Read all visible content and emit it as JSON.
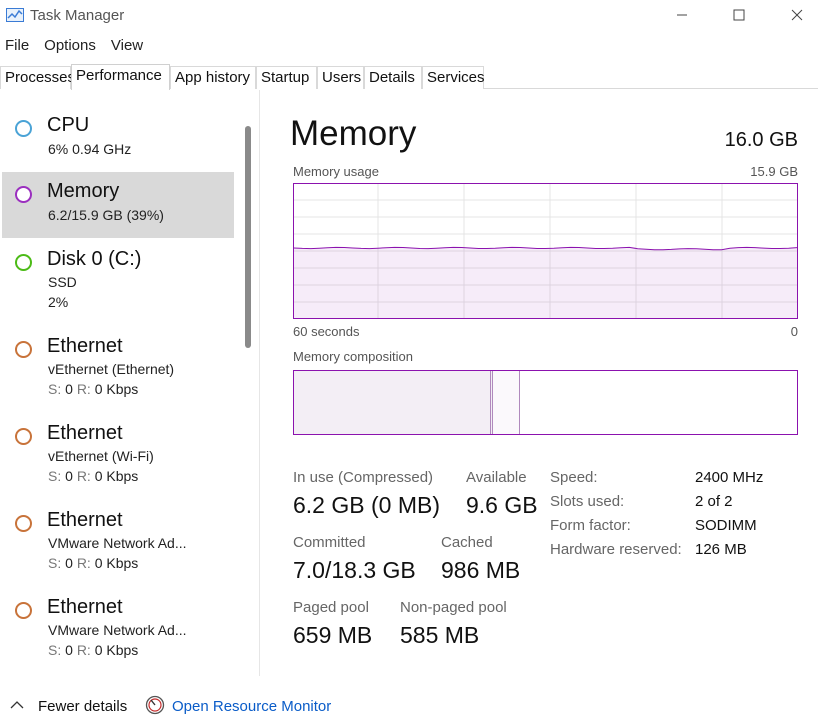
{
  "window": {
    "title": "Task Manager",
    "controls": [
      "minimize",
      "maximize",
      "close"
    ]
  },
  "menu": [
    "File",
    "Options",
    "View"
  ],
  "tabs": [
    {
      "label": "Processes",
      "active": false
    },
    {
      "label": "Performance",
      "active": true
    },
    {
      "label": "App history",
      "active": false
    },
    {
      "label": "Startup",
      "active": false
    },
    {
      "label": "Users",
      "active": false
    },
    {
      "label": "Details",
      "active": false
    },
    {
      "label": "Services",
      "active": false
    }
  ],
  "resources": [
    {
      "title": "CPU",
      "line1": "6%  0.94 GHz",
      "line2": "",
      "color": "#4aa3d6",
      "selected": false
    },
    {
      "title": "Memory",
      "line1": "6.2/15.9 GB (39%)",
      "line2": "",
      "color": "#9b2fbf",
      "selected": true
    },
    {
      "title": "Disk 0 (C:)",
      "line1": "SSD",
      "line2": "2%",
      "color": "#4cbb17",
      "selected": false
    },
    {
      "title": "Ethernet",
      "line1": "vEthernet (Ethernet)",
      "send_label": "S:",
      "send": "0",
      "recv_label": "R:",
      "recv": "0 Kbps",
      "color": "#c8733a",
      "selected": false
    },
    {
      "title": "Ethernet",
      "line1": "vEthernet (Wi-Fi)",
      "send_label": "S:",
      "send": "0",
      "recv_label": "R:",
      "recv": "0 Kbps",
      "color": "#c8733a",
      "selected": false
    },
    {
      "title": "Ethernet",
      "line1": "VMware Network Ad...",
      "send_label": "S:",
      "send": "0",
      "recv_label": "R:",
      "recv": "0 Kbps",
      "color": "#c8733a",
      "selected": false
    },
    {
      "title": "Ethernet",
      "line1": "VMware Network Ad...",
      "send_label": "S:",
      "send": "0",
      "recv_label": "R:",
      "recv": "0 Kbps",
      "color": "#c8733a",
      "selected": false
    }
  ],
  "memory": {
    "heading": "Memory",
    "total": "16.0 GB",
    "usage_label": "Memory usage",
    "usage_max": "15.9 GB",
    "time_left": "60 seconds",
    "time_right": "0",
    "composition_label": "Memory composition",
    "usage_fraction": 0.39,
    "stats": {
      "in_use_label": "In use (Compressed)",
      "in_use_value": "6.2 GB (0 MB)",
      "available_label": "Available",
      "available_value": "9.6 GB",
      "committed_label": "Committed",
      "committed_value": "7.0/18.3 GB",
      "cached_label": "Cached",
      "cached_value": "986 MB",
      "paged_label": "Paged pool",
      "paged_value": "659 MB",
      "nonpaged_label": "Non-paged pool",
      "nonpaged_value": "585 MB"
    },
    "specs": [
      {
        "label": "Speed:",
        "value": "2400 MHz"
      },
      {
        "label": "Slots used:",
        "value": "2 of 2"
      },
      {
        "label": "Form factor:",
        "value": "SODIMM"
      },
      {
        "label": "Hardware reserved:",
        "value": "126 MB"
      }
    ]
  },
  "footer": {
    "fewer_details": "Fewer details",
    "open_monitor": "Open Resource Monitor"
  },
  "colors": {
    "memory_accent": "#8b12ae",
    "link": "#0a5cc8",
    "selected_bg": "#d9d9d9"
  }
}
